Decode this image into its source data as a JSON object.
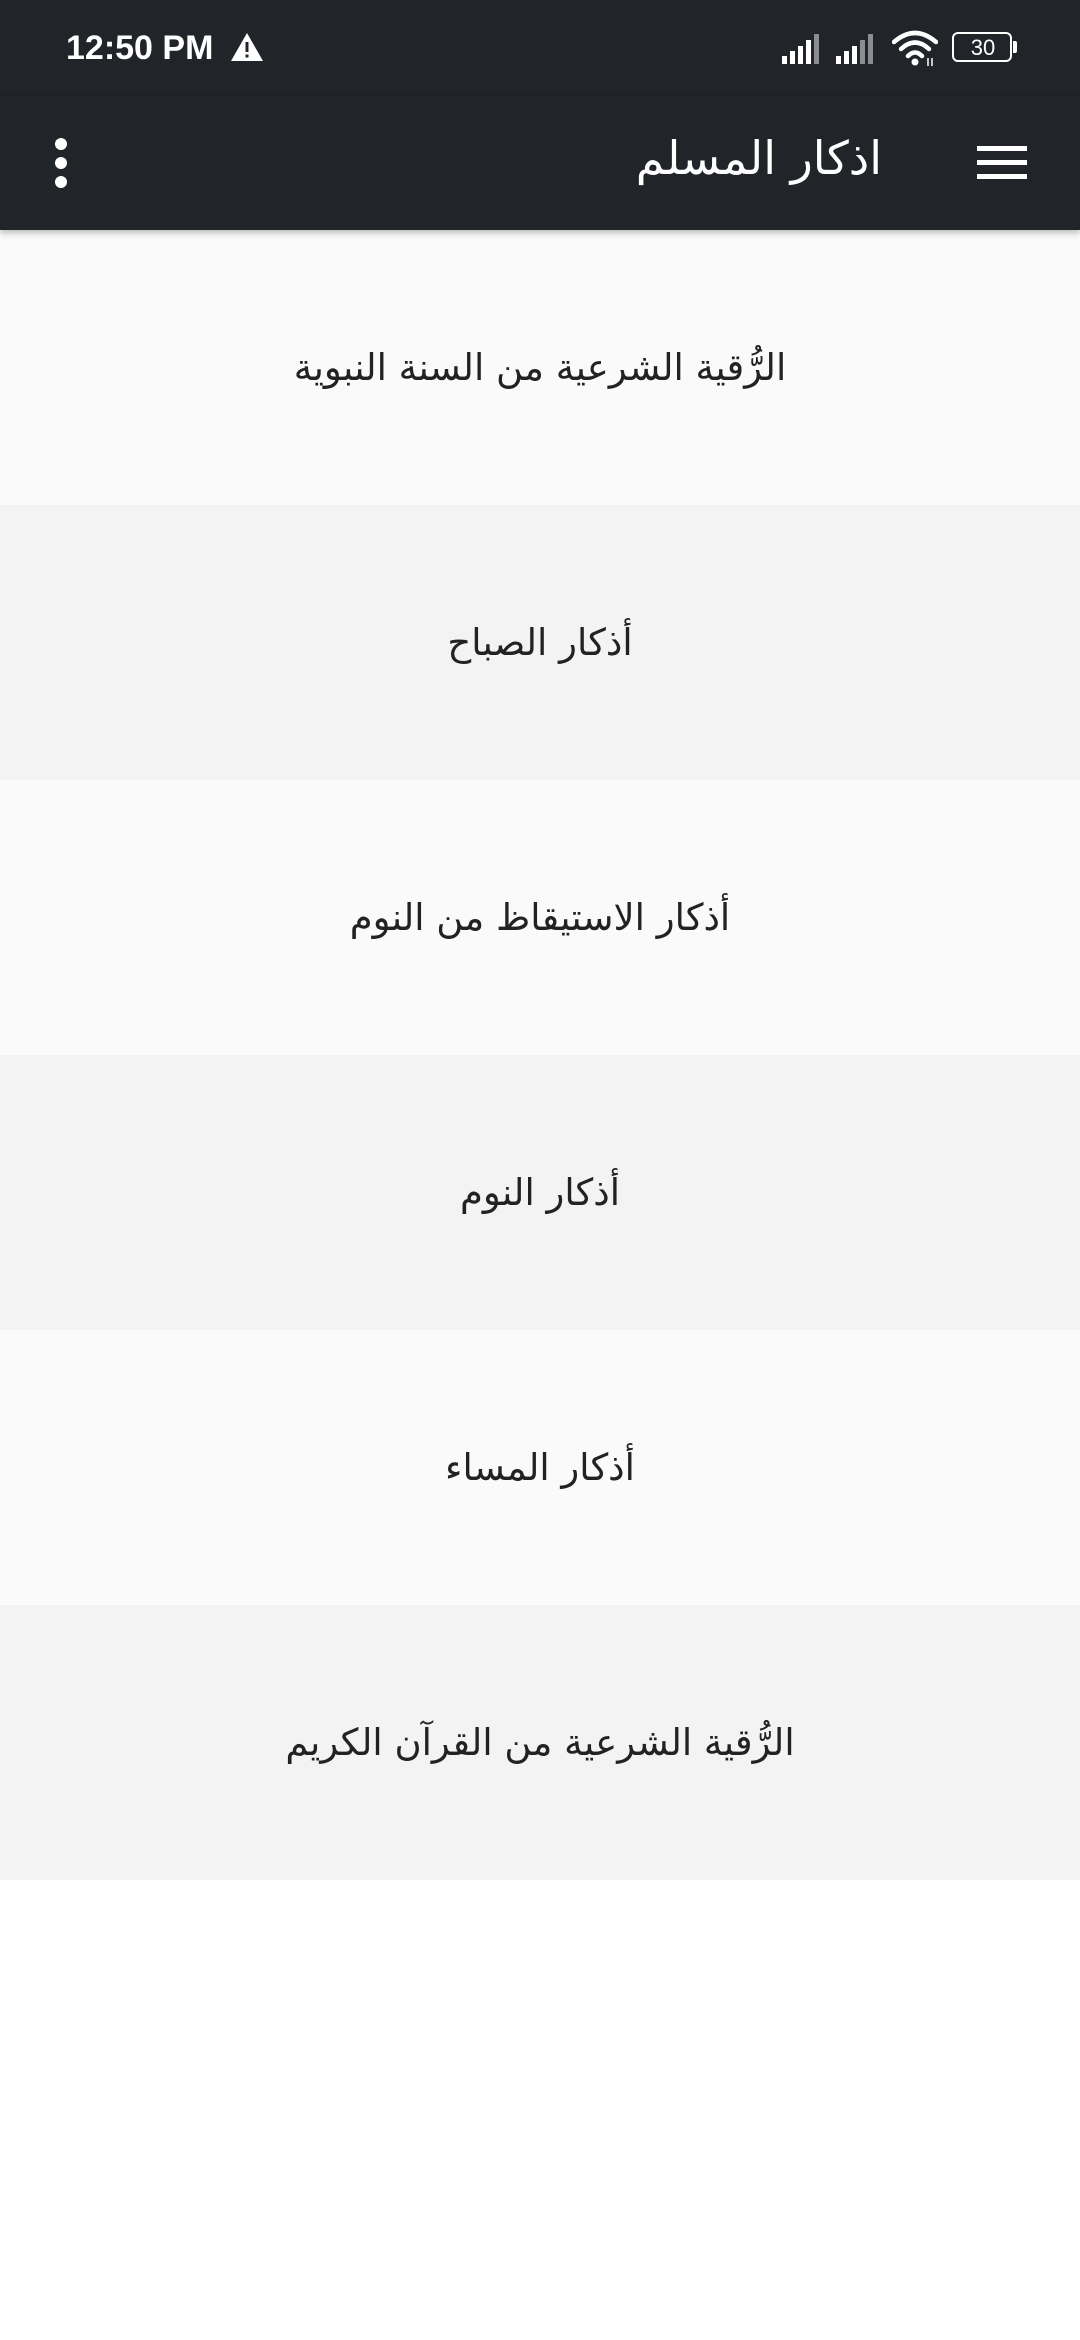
{
  "status_bar": {
    "time": "12:50 PM",
    "battery_level": "30",
    "icons": [
      "alert-icon",
      "signal-icon",
      "signal-icon",
      "wifi-icon",
      "battery-icon"
    ]
  },
  "app_bar": {
    "title": "اذكار المسلم",
    "menu_icon": "hamburger-menu-icon",
    "overflow_icon": "more-vert-icon",
    "background": "#212429"
  },
  "list": {
    "items": [
      {
        "label": "الرُّقية الشرعية من السنة النبوية"
      },
      {
        "label": "أذكار الصباح"
      },
      {
        "label": "أذكار الاستيقاظ من النوم"
      },
      {
        "label": "أذكار النوم"
      },
      {
        "label": "أذكار المساء"
      },
      {
        "label": "الرُّقية الشرعية من القرآن الكريم"
      }
    ],
    "row_colors": [
      "#fafafa",
      "#f3f3f3"
    ]
  }
}
